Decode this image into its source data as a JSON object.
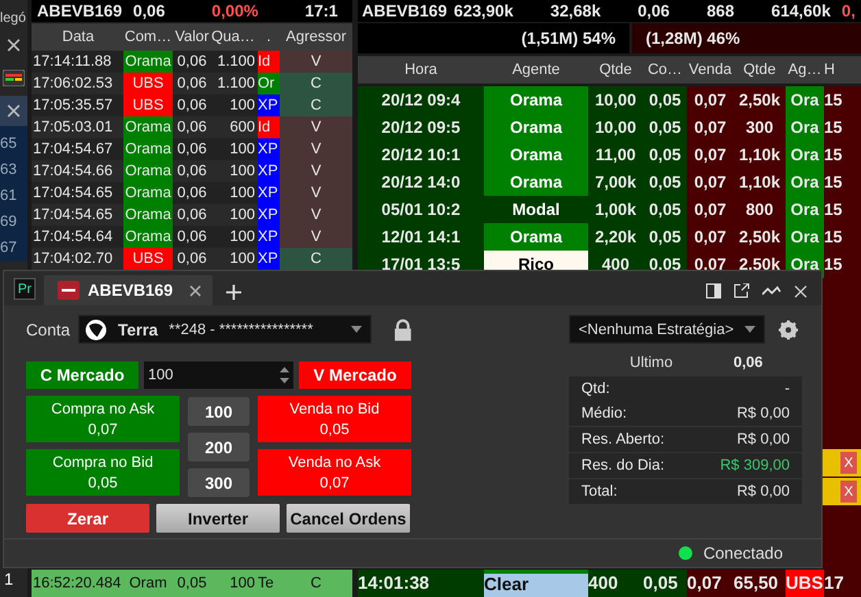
{
  "left_strip": {
    "title": "legó",
    "numbers": [
      "65",
      "63",
      "61",
      "69",
      "67"
    ],
    "bottom_number": "1"
  },
  "trades": {
    "header": {
      "symbol": "ABEVB169",
      "last": "0,06",
      "change": "0,00%",
      "time": "17:1"
    },
    "columns": [
      "Data",
      "Com…",
      "Valor",
      "Qua…",
      ".",
      "Agressor"
    ],
    "rows": [
      {
        "time": "17:14:11.88",
        "broker": {
          "text": "Orama",
          "color": "#008000"
        },
        "price": "0,06",
        "qty": "1.100",
        "counter": {
          "text": "Id",
          "color": "#ff0000"
        },
        "side": {
          "text": "V",
          "color": "#4b3434"
        }
      },
      {
        "time": "17:06:02.53",
        "broker": {
          "text": "UBS",
          "color": "#ff0000"
        },
        "price": "0,06",
        "qty": "1.100",
        "counter": {
          "text": "Or",
          "color": "#008000"
        },
        "side": {
          "text": "C",
          "color": "#2c5440"
        }
      },
      {
        "time": "17:05:35.57",
        "broker": {
          "text": "UBS",
          "color": "#ff0000"
        },
        "price": "0,06",
        "qty": "100",
        "counter": {
          "text": "XP",
          "color": "#0000ff"
        },
        "side": {
          "text": "C",
          "color": "#2c5440"
        }
      },
      {
        "time": "17:05:03.01",
        "broker": {
          "text": "Orama",
          "color": "#008000"
        },
        "price": "0,06",
        "qty": "600",
        "counter": {
          "text": "Id",
          "color": "#ff0000"
        },
        "side": {
          "text": "V",
          "color": "#4b3434"
        }
      },
      {
        "time": "17:04:54.67",
        "broker": {
          "text": "Orama",
          "color": "#008000"
        },
        "price": "0,06",
        "qty": "100",
        "counter": {
          "text": "XP",
          "color": "#0000ff"
        },
        "side": {
          "text": "V",
          "color": "#4b3434"
        }
      },
      {
        "time": "17:04:54.66",
        "broker": {
          "text": "Orama",
          "color": "#008000"
        },
        "price": "0,06",
        "qty": "100",
        "counter": {
          "text": "XP",
          "color": "#0000ff"
        },
        "side": {
          "text": "V",
          "color": "#4b3434"
        }
      },
      {
        "time": "17:04:54.65",
        "broker": {
          "text": "Orama",
          "color": "#008000"
        },
        "price": "0,06",
        "qty": "100",
        "counter": {
          "text": "XP",
          "color": "#0000ff"
        },
        "side": {
          "text": "V",
          "color": "#4b3434"
        }
      },
      {
        "time": "17:04:54.65",
        "broker": {
          "text": "Orama",
          "color": "#008000"
        },
        "price": "0,06",
        "qty": "100",
        "counter": {
          "text": "XP",
          "color": "#0000ff"
        },
        "side": {
          "text": "V",
          "color": "#4b3434"
        }
      },
      {
        "time": "17:04:54.64",
        "broker": {
          "text": "Orama",
          "color": "#008000"
        },
        "price": "0,06",
        "qty": "100",
        "counter": {
          "text": "XP",
          "color": "#0000ff"
        },
        "side": {
          "text": "V",
          "color": "#4b3434"
        }
      },
      {
        "time": "17:04:02.70",
        "broker": {
          "text": "UBS",
          "color": "#ff0000"
        },
        "price": "0,06",
        "qty": "100",
        "counter": {
          "text": "XP",
          "color": "#0000ff"
        },
        "side": {
          "text": "C",
          "color": "#2c5440"
        }
      }
    ],
    "bottom_row": {
      "time": "16:52:20.484",
      "broker": "Oram",
      "price": "0,05",
      "qty": "100",
      "counter": "Te",
      "side": "C"
    }
  },
  "book": {
    "summary": {
      "symbol": "ABEVB169",
      "values": [
        "623,90k",
        "32,68k",
        "0,06",
        "868",
        "614,60k"
      ],
      "change": "0,"
    },
    "pressure": {
      "buy": "(1,51M) 54%",
      "sell": "(1,28M) 46%"
    },
    "columns": [
      "Hora",
      "Agente",
      "Qtde",
      "Co…",
      "Venda",
      "Qtde",
      "Ag…",
      "H"
    ],
    "rows": [
      {
        "time": "20/12 09:4",
        "agent": {
          "text": "Orama",
          "color": "#008000"
        },
        "qty": "10,00",
        "bid": "0,05",
        "ask": "0,07",
        "ask_qty": "2,50k",
        "ask_agent": "Ora",
        "extra": "15"
      },
      {
        "time": "20/12 09:5",
        "agent": {
          "text": "Orama",
          "color": "#008000"
        },
        "qty": "10,00",
        "bid": "0,05",
        "ask": "0,07",
        "ask_qty": "300",
        "ask_agent": "Ora",
        "extra": "15"
      },
      {
        "time": "20/12 10:1",
        "agent": {
          "text": "Orama",
          "color": "#008000"
        },
        "qty": "11,00",
        "bid": "0,05",
        "ask": "0,07",
        "ask_qty": "1,10k",
        "ask_agent": "Ora",
        "extra": "15"
      },
      {
        "time": "20/12 14:0",
        "agent": {
          "text": "Orama",
          "color": "#008000"
        },
        "qty": "7,00k",
        "bid": "0,05",
        "ask": "0,07",
        "ask_qty": "1,10k",
        "ask_agent": "Ora",
        "extra": "15"
      },
      {
        "time": "05/01 10:2",
        "agent": {
          "text": "Modal",
          "color": "#003c00"
        },
        "qty": "1,00k",
        "bid": "0,05",
        "ask": "0,07",
        "ask_qty": "800",
        "ask_agent": "Ora",
        "extra": "15"
      },
      {
        "time": "12/01 14:1",
        "agent": {
          "text": "Orama",
          "color": "#008000"
        },
        "qty": "2,20k",
        "bid": "0,05",
        "ask": "0,07",
        "ask_qty": "2,50k",
        "ask_agent": "Ora",
        "extra": "15"
      },
      {
        "time": "17/01 13:5",
        "agent": {
          "text": "Rico",
          "color": "#fff8ee"
        },
        "qty": "400",
        "bid": "0,05",
        "ask": "0,07",
        "ask_qty": "2,50k",
        "ask_agent": "Ora",
        "extra": "15"
      }
    ],
    "side_buttons": [
      "X",
      "X"
    ],
    "bottom_row": {
      "time": "14:01:38",
      "agent": "Clear",
      "qty": "400",
      "bid": "0,05",
      "ask": "0,07",
      "ask_qty": "65,50",
      "ask_agent": "UBS",
      "extra": "17"
    }
  },
  "order_window": {
    "app_badge": "Pr",
    "tabs": [
      {
        "label": "ABEVB169",
        "selected": true
      }
    ],
    "account": {
      "label": "Conta",
      "broker": "Terra",
      "number": "**248 - ****************"
    },
    "strategy": "<Nenhuma Estratégia>",
    "market_buy": "C Mercado",
    "quantity": "100",
    "market_sell": "V Mercado",
    "buy_buttons": [
      {
        "label": "Compra no Ask",
        "price": "0,07"
      },
      {
        "label": "Compra no Bid",
        "price": "0,05"
      }
    ],
    "quick_quantities": [
      "100",
      "200",
      "300"
    ],
    "sell_buttons": [
      {
        "label": "Venda no Bid",
        "price": "0,05"
      },
      {
        "label": "Venda no Ask",
        "price": "0,07"
      }
    ],
    "actions": [
      {
        "label": "Zerar",
        "kind": "danger"
      },
      {
        "label": "Inverter",
        "kind": "plain"
      },
      {
        "label": "Cancel Ordens",
        "kind": "plain"
      }
    ],
    "last": {
      "label": "Ultimo",
      "value": "0,06"
    },
    "position": [
      {
        "items": [
          {
            "label": "Qtd:",
            "value": "-",
            "color": "#e0e0e0"
          },
          {
            "label": "Médio:",
            "value": "R$ 0,00",
            "color": "#e0e0e0"
          }
        ]
      },
      {
        "items": [
          {
            "label": "Res. Aberto:",
            "value": "R$ 0,00",
            "color": "#e0e0e0"
          }
        ]
      },
      {
        "items": [
          {
            "label": "Res. do Dia:",
            "value": "R$ 309,00",
            "color": "#3ec46d"
          }
        ]
      },
      {
        "items": [
          {
            "label": "Total:",
            "value": "R$ 0,00",
            "color": "#e0e0e0"
          }
        ]
      }
    ],
    "status": {
      "text": "Conectado",
      "connected": true
    }
  }
}
